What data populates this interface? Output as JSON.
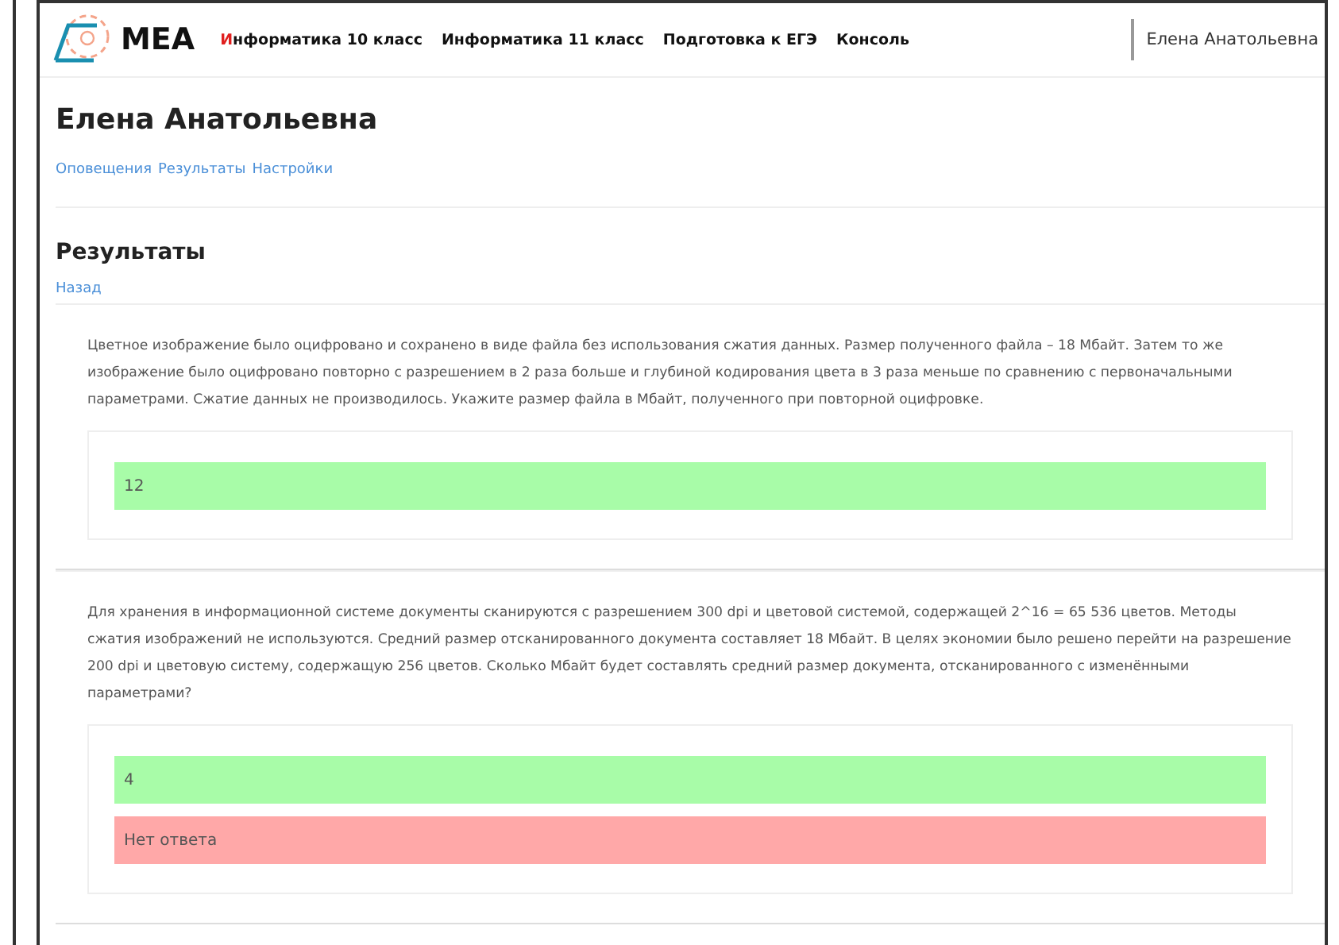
{
  "header": {
    "logo": "МЕА",
    "nav": [
      {
        "label": "Информатика 10 класс",
        "selected": true
      },
      {
        "label": "Информатика 11 класс",
        "selected": false
      },
      {
        "label": "Подготовка к ЕГЭ",
        "selected": false
      },
      {
        "label": "Консоль",
        "selected": false
      }
    ],
    "user": "Елена Анатольевна"
  },
  "profile": {
    "name": "Елена Анатольевна",
    "links": [
      "Оповещения",
      "Результаты",
      "Настройки"
    ]
  },
  "results": {
    "title": "Результаты",
    "back": "Назад",
    "questions": [
      {
        "text": "Цветное изображение было оцифровано и сохранено в виде файла без использования сжатия данных. Размер полученного файла – 18 Мбайт. Затем то же изображение было оцифровано повторно с разрешением в 2 раза больше и глубиной кодирования цвета в 3 раза меньше по сравнению с первоначальными параметрами. Сжатие данных не производилось. Укажите размер файла в Мбайт, полученного при повторной оцифровке.",
        "answers": [
          {
            "kind": "correct",
            "text": "12"
          }
        ]
      },
      {
        "text": "Для хранения в информационной системе документы сканируются с разрешением 300 dpi и цветовой системой, содержащей 2^16 = 65 536 цветов. Методы сжатия изображений не используются. Средний размер отсканированного документа составляет 18 Мбайт. В целях экономии было решено перейти на разрешение 200 dpi и цветовую систему, содержащую 256 цветов. Сколько Мбайт будет составлять средний размер документа, отсканированного с изменёнными параметрами?",
        "answers": [
          {
            "kind": "correct",
            "text": "4"
          },
          {
            "kind": "wrong",
            "text": "Нет ответа"
          }
        ]
      }
    ]
  }
}
